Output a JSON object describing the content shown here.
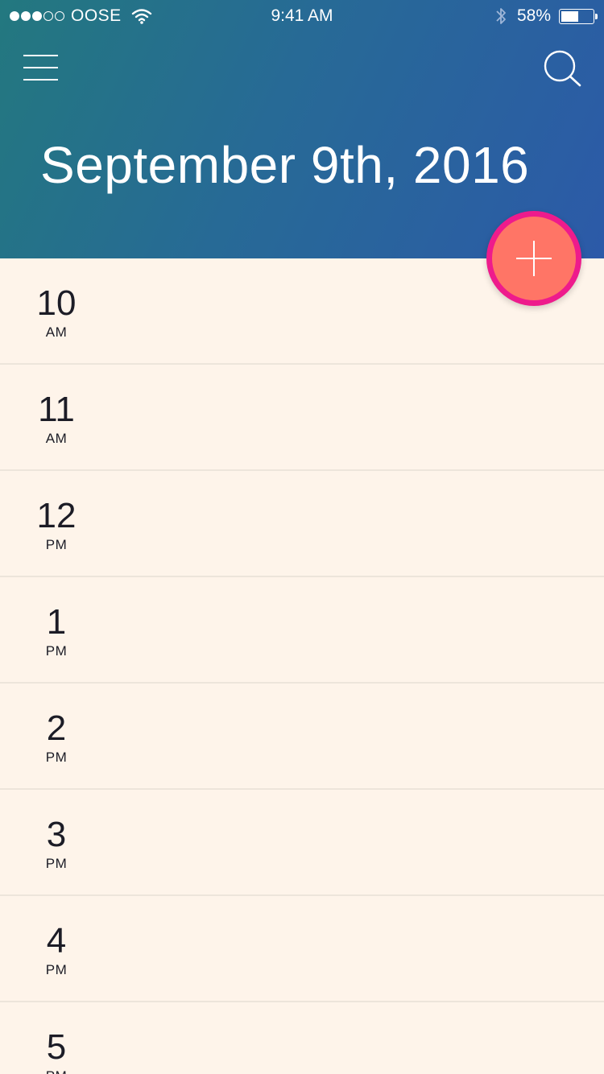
{
  "status_bar": {
    "carrier": "OOSE",
    "time": "9:41 AM",
    "battery_percent_text": "58%",
    "battery_level": 0.58,
    "signal_bars_filled": 3,
    "signal_bars_total": 5
  },
  "header": {
    "date_title": "September 9th, 2016",
    "menu_icon": "hamburger-menu-icon",
    "search_icon": "search-icon"
  },
  "timeline": {
    "hours": [
      {
        "hour": "10",
        "meridiem": "AM"
      },
      {
        "hour": "11",
        "meridiem": "AM"
      },
      {
        "hour": "12",
        "meridiem": "PM"
      },
      {
        "hour": "1",
        "meridiem": "PM"
      },
      {
        "hour": "2",
        "meridiem": "PM"
      },
      {
        "hour": "3",
        "meridiem": "PM"
      },
      {
        "hour": "4",
        "meridiem": "PM"
      },
      {
        "hour": "5",
        "meridiem": "PM"
      }
    ]
  },
  "fab": {
    "icon": "plus-icon"
  },
  "colors": {
    "header_gradient_start": "#23787F",
    "header_gradient_end": "#2C5AA8",
    "background": "#FEF4EA",
    "fab_fill": "#FF7566",
    "fab_ring": "#EE1B8C",
    "row_divider": "#EDE5DB"
  }
}
